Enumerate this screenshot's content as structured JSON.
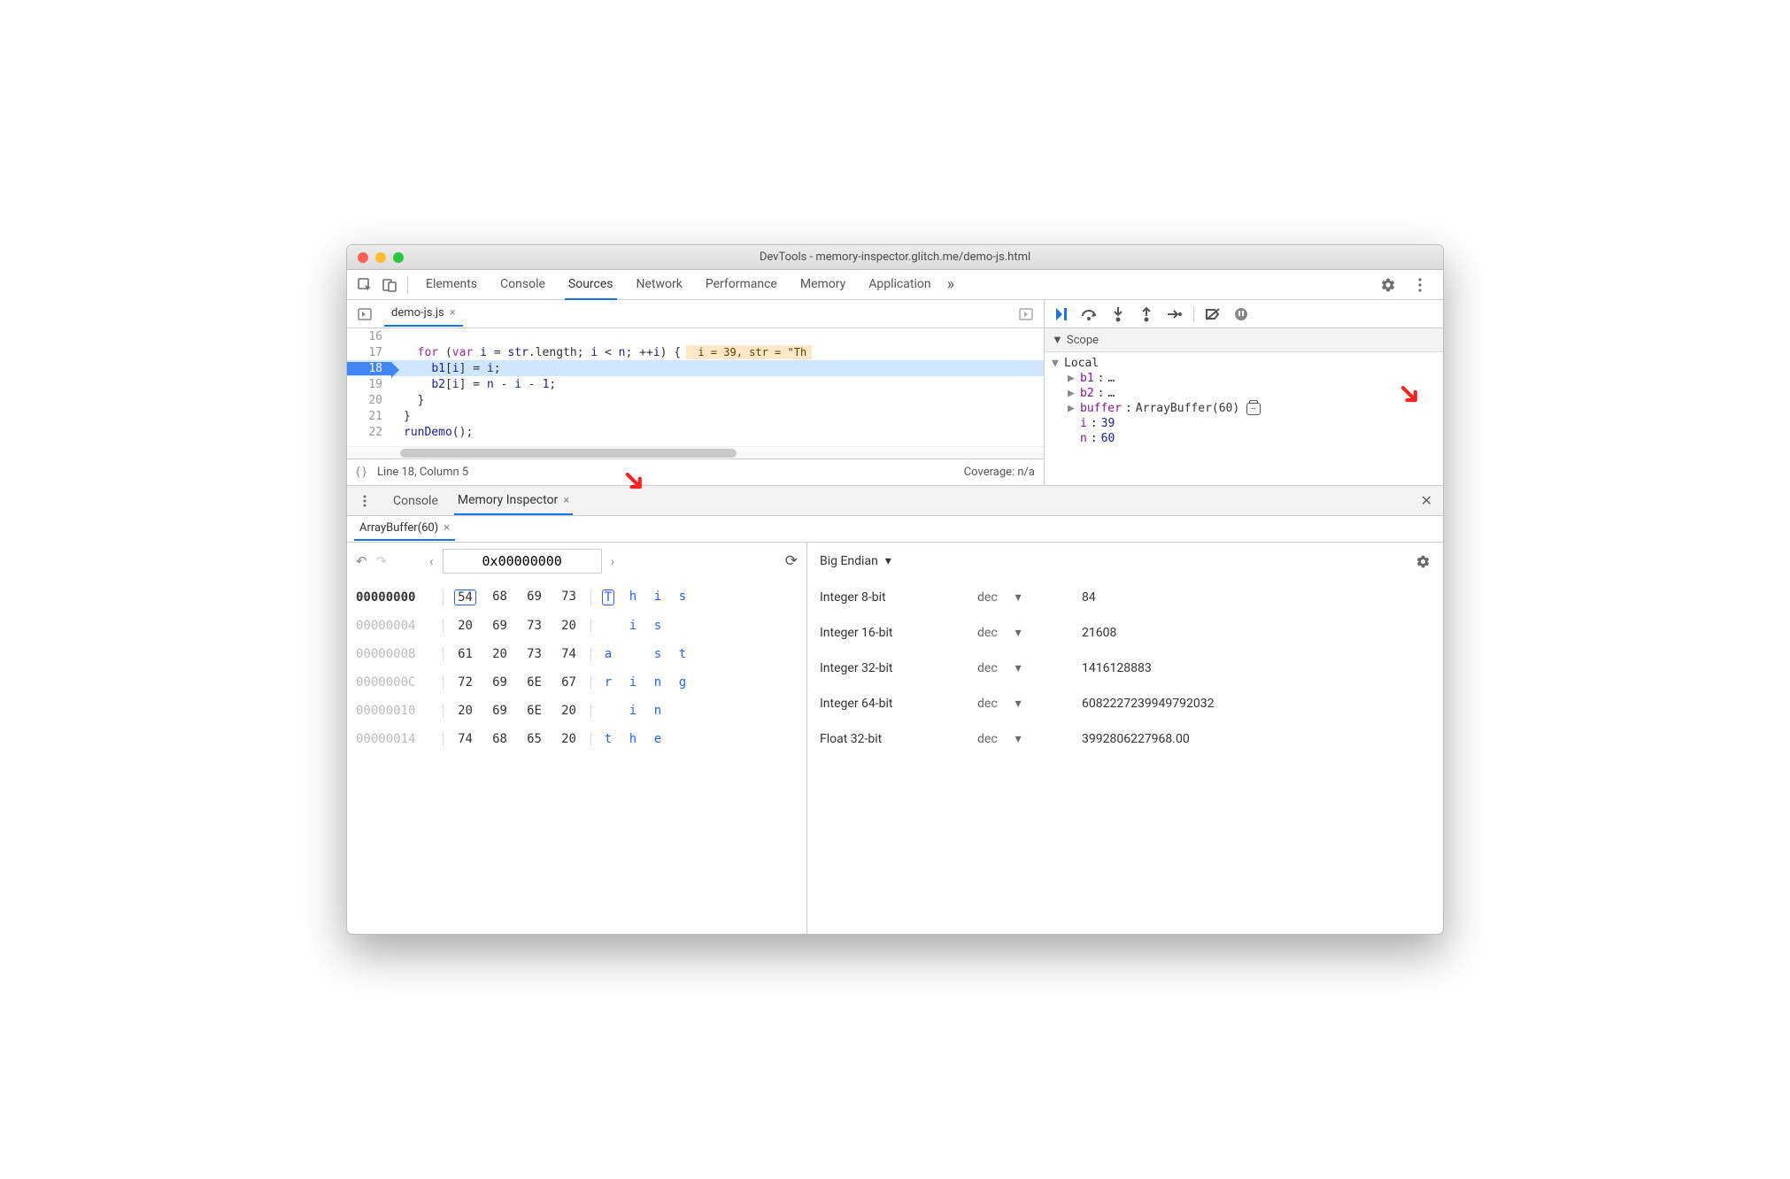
{
  "window": {
    "title": "DevTools - memory-inspector.glitch.me/demo-js.html"
  },
  "mainTabs": [
    "Elements",
    "Console",
    "Sources",
    "Network",
    "Performance",
    "Memory",
    "Application"
  ],
  "activeTab": "Sources",
  "fileTab": {
    "name": "demo-js.js"
  },
  "code": {
    "lines": [
      {
        "n": 16,
        "text": ""
      },
      {
        "n": 17,
        "text": "  for (var i = str.length; i < n; ++i) {",
        "hint": " i = 39, str = \"Th"
      },
      {
        "n": 18,
        "text": "    b1[i] = i;",
        "bp": true,
        "cur": true
      },
      {
        "n": 19,
        "text": "    b2[i] = n - i - 1;"
      },
      {
        "n": 20,
        "text": "  }"
      },
      {
        "n": 21,
        "text": "}"
      },
      {
        "n": 22,
        "text": "runDemo();"
      }
    ]
  },
  "status": {
    "position": "Line 18, Column 5",
    "coverage": "Coverage: n/a"
  },
  "scope": {
    "title": "Scope",
    "local": "Local",
    "items": [
      {
        "name": "b1",
        "value": "…",
        "expandable": true
      },
      {
        "name": "b2",
        "value": "…",
        "expandable": true
      },
      {
        "name": "buffer",
        "value": "ArrayBuffer(60)",
        "expandable": true,
        "mem": true
      },
      {
        "name": "i",
        "value": "39"
      },
      {
        "name": "n",
        "value": "60"
      }
    ]
  },
  "drawer": {
    "tabs": [
      "Console",
      "Memory Inspector"
    ],
    "active": "Memory Inspector",
    "bufferTab": "ArrayBuffer(60)"
  },
  "hex": {
    "address": "0x00000000",
    "rows": [
      {
        "addr": "00000000",
        "bytes": [
          "54",
          "68",
          "69",
          "73"
        ],
        "ascii": [
          "T",
          "h",
          "i",
          "s"
        ],
        "first": true
      },
      {
        "addr": "00000004",
        "bytes": [
          "20",
          "69",
          "73",
          "20"
        ],
        "ascii": [
          " ",
          "i",
          "s",
          " "
        ]
      },
      {
        "addr": "00000008",
        "bytes": [
          "61",
          "20",
          "73",
          "74"
        ],
        "ascii": [
          "a",
          " ",
          "s",
          "t"
        ]
      },
      {
        "addr": "0000000C",
        "bytes": [
          "72",
          "69",
          "6E",
          "67"
        ],
        "ascii": [
          "r",
          "i",
          "n",
          "g"
        ]
      },
      {
        "addr": "00000010",
        "bytes": [
          "20",
          "69",
          "6E",
          "20"
        ],
        "ascii": [
          " ",
          "i",
          "n",
          " "
        ]
      },
      {
        "addr": "00000014",
        "bytes": [
          "74",
          "68",
          "65",
          "20"
        ],
        "ascii": [
          "t",
          "h",
          "e",
          " "
        ]
      }
    ]
  },
  "values": {
    "endian": "Big Endian",
    "rows": [
      {
        "type": "Integer 8-bit",
        "base": "dec",
        "value": "84"
      },
      {
        "type": "Integer 16-bit",
        "base": "dec",
        "value": "21608"
      },
      {
        "type": "Integer 32-bit",
        "base": "dec",
        "value": "1416128883"
      },
      {
        "type": "Integer 64-bit",
        "base": "dec",
        "value": "6082227239949792032"
      },
      {
        "type": "Float 32-bit",
        "base": "dec",
        "value": "3992806227968.00"
      }
    ]
  }
}
